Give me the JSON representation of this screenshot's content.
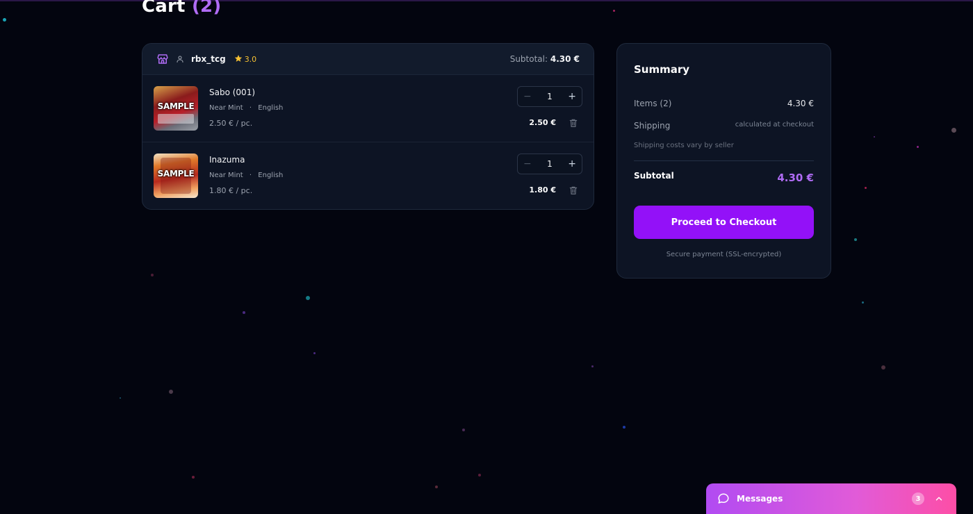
{
  "page": {
    "title": "Cart",
    "title_count": "(2)"
  },
  "seller": {
    "name": "rbx_tcg",
    "rating": "3.0",
    "subtotal_label": "Subtotal:",
    "subtotal_value": "4.30 €",
    "items": [
      {
        "name": "Sabo (001)",
        "condition": "Near Mint",
        "language": "English",
        "unit_price": "2.50 € / pc.",
        "quantity": "1",
        "line_total": "2.50 €",
        "thumb_label": "SAMPLE"
      },
      {
        "name": "Inazuma",
        "condition": "Near Mint",
        "language": "English",
        "unit_price": "1.80 € / pc.",
        "quantity": "1",
        "line_total": "1.80 €",
        "thumb_label": "SAMPLE"
      }
    ]
  },
  "summary": {
    "title": "Summary",
    "items_label": "Items (2)",
    "items_value": "4.30 €",
    "shipping_label": "Shipping",
    "shipping_value": "calculated at checkout",
    "shipping_note": "Shipping costs vary by seller",
    "subtotal_label": "Subtotal",
    "subtotal_value": "4.30 €",
    "checkout_label": "Proceed to Checkout",
    "secure_note": "Secure payment (SSL-encrypted)"
  },
  "messages": {
    "label": "Messages",
    "count": "3"
  },
  "colors": {
    "background": "#03050f",
    "accent": "#9311f8",
    "accent_text": "#b06cf5",
    "star": "#f5c033"
  },
  "icons": {
    "shop": "store-icon",
    "user": "user-icon",
    "star": "star-icon",
    "trash": "trash-icon",
    "chat": "chat-bubble-icon",
    "chevron": "chevron-up-icon"
  }
}
